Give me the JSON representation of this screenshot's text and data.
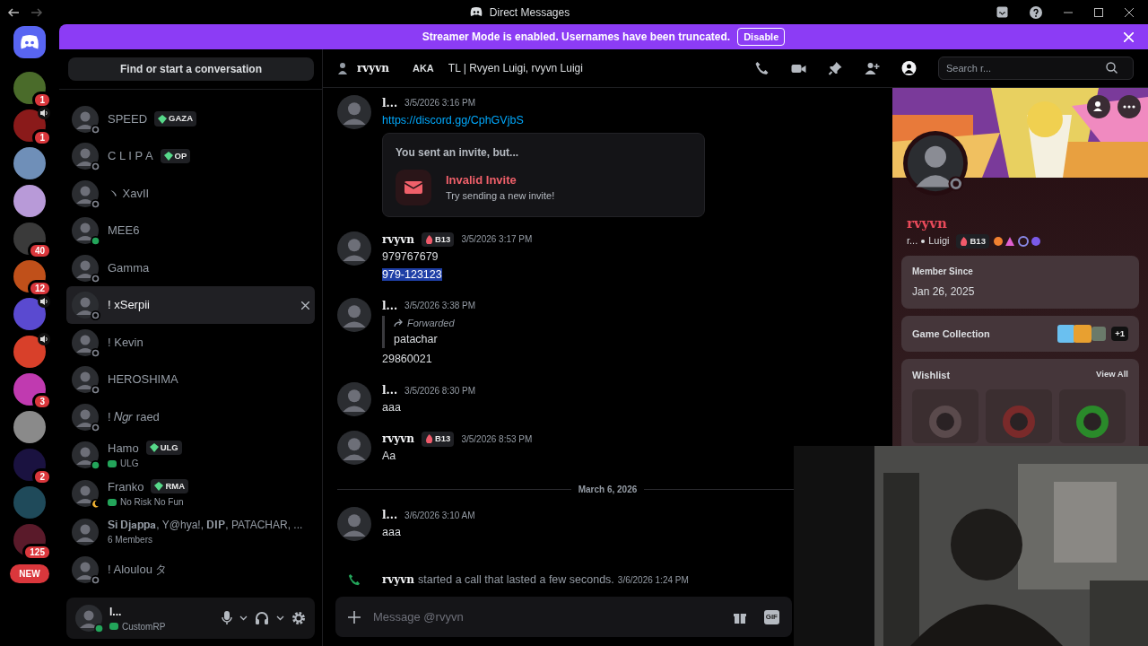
{
  "window": {
    "title": "Direct Messages"
  },
  "banner": {
    "text": "Streamer Mode is enabled. Usernames have been truncated.",
    "button": "Disable"
  },
  "servers": [
    {
      "color": "#4a6b2a",
      "badge": "1",
      "voice": false
    },
    {
      "color": "#8a1a1a",
      "badge": "1",
      "voice": true
    },
    {
      "color": "#6f8fb8",
      "voice": false
    },
    {
      "color": "#b89ad8",
      "voice": false
    },
    {
      "color": "#3a3a3a",
      "badge": "40",
      "voice": false
    },
    {
      "color": "#c0501a",
      "badge": "12",
      "voice": false
    },
    {
      "color": "#5a4ad0",
      "voice": true
    },
    {
      "color": "#d8402a",
      "voice": true
    },
    {
      "color": "#c03ab0",
      "badge": "3",
      "voice": false
    },
    {
      "color": "#8a8a8a",
      "voice": false
    },
    {
      "color": "#1a1240",
      "badge": "2",
      "voice": false
    },
    {
      "color": "#1f4a5a",
      "voice": false
    },
    {
      "color": "#5a1a2a",
      "badge": "125",
      "voice": false
    }
  ],
  "new_button": "NEW",
  "dm_search": {
    "label": "Find or start a conversation"
  },
  "dms": [
    {
      "name": "SPEED",
      "tag": "GAZA",
      "online": false,
      "selected": false
    },
    {
      "name": "C L I P A",
      "tag": "OP",
      "online": false,
      "selected": false
    },
    {
      "name": "ヽ XavII",
      "online": false,
      "selected": false
    },
    {
      "name": "MEE6",
      "online": true,
      "selected": false
    },
    {
      "name": "Gamma",
      "online": false,
      "selected": false
    },
    {
      "name": "! xSerpii",
      "online": false,
      "selected": true
    },
    {
      "name": "! Kevin",
      "online": false,
      "selected": false
    },
    {
      "name": "HEROSHIMA",
      "online": false,
      "selected": false
    },
    {
      "name": "! 𝑁𝑔𝑟 raed",
      "online": false,
      "selected": false
    },
    {
      "name": "Hamo",
      "tag": "ULG",
      "subtitle": "ULG",
      "online": true,
      "selected": false
    },
    {
      "name": "Franko",
      "tag": "RMA",
      "subtitle": "No Risk No Fun",
      "idle": true,
      "selected": false
    },
    {
      "name": "𝐒𝐢 𝐃𝐣𝐚𝐩𝐩𝐚, Y@hya!, 𝐃𝐈𝐏, PATACHAR, ...",
      "subtitle": "6 Members",
      "selected": false
    },
    {
      "name": "! Aloulou タ",
      "online": false,
      "selected": false
    }
  ],
  "user_panel": {
    "name": "l...",
    "activity": "CustomRP",
    "online": true
  },
  "chat_header": {
    "name": "rvyvn",
    "aka": "AKA",
    "aliases": "TL | Rvyen Luigi, rvyvn Luigi",
    "search": {
      "placeholder": "Search r..."
    }
  },
  "messages": [
    {
      "kind": "message",
      "author": "l...",
      "time": "3/5/2026 3:16 PM",
      "link": "https://discord.gg/CphGVjbS",
      "invite": {
        "heading": "You sent an invite, but...",
        "title": "Invalid Invite",
        "subtitle": "Try sending a new invite!"
      }
    },
    {
      "kind": "message",
      "author": "rvyvn",
      "tag": "B13",
      "time": "3/5/2026 3:17 PM",
      "lines": [
        {
          "text": "979767679",
          "highlighted": false
        },
        {
          "text": "979-123123",
          "highlighted": true
        }
      ]
    },
    {
      "kind": "message",
      "author": "l...",
      "time": "3/5/2026 3:38 PM",
      "forwarded": {
        "label": "Forwarded",
        "text": "patachar"
      },
      "lines": [
        {
          "text": "29860021",
          "highlighted": false
        }
      ]
    },
    {
      "kind": "message",
      "author": "l...",
      "time": "3/5/2026 8:30 PM",
      "lines": [
        {
          "text": "aaa",
          "highlighted": false
        }
      ]
    },
    {
      "kind": "message",
      "author": "rvyvn",
      "tag": "B13",
      "time": "3/5/2026 8:53 PM",
      "lines": [
        {
          "text": "Aa",
          "highlighted": false
        }
      ]
    },
    {
      "kind": "divider",
      "text": "March 6, 2026"
    },
    {
      "kind": "message",
      "author": "l...",
      "time": "3/6/2026 3:10 AM",
      "lines": [
        {
          "text": "aaa",
          "highlighted": false
        }
      ]
    },
    {
      "kind": "call",
      "author": "rvyvn",
      "text": "started a call that lasted a few seconds.",
      "time": "3/6/2026 1:24 PM"
    }
  ],
  "composer": {
    "placeholder": "Message @rvyvn",
    "gif": "GIF"
  },
  "profile": {
    "name": "rvyvn",
    "handle": "r...",
    "pronoun": "Luigi",
    "tag": "B13",
    "member_since_label": "Member Since",
    "member_since": "Jan 26, 2025",
    "games_label": "Game Collection",
    "games_more": "+1",
    "wishlist_label": "Wishlist",
    "view_all": "View All"
  }
}
